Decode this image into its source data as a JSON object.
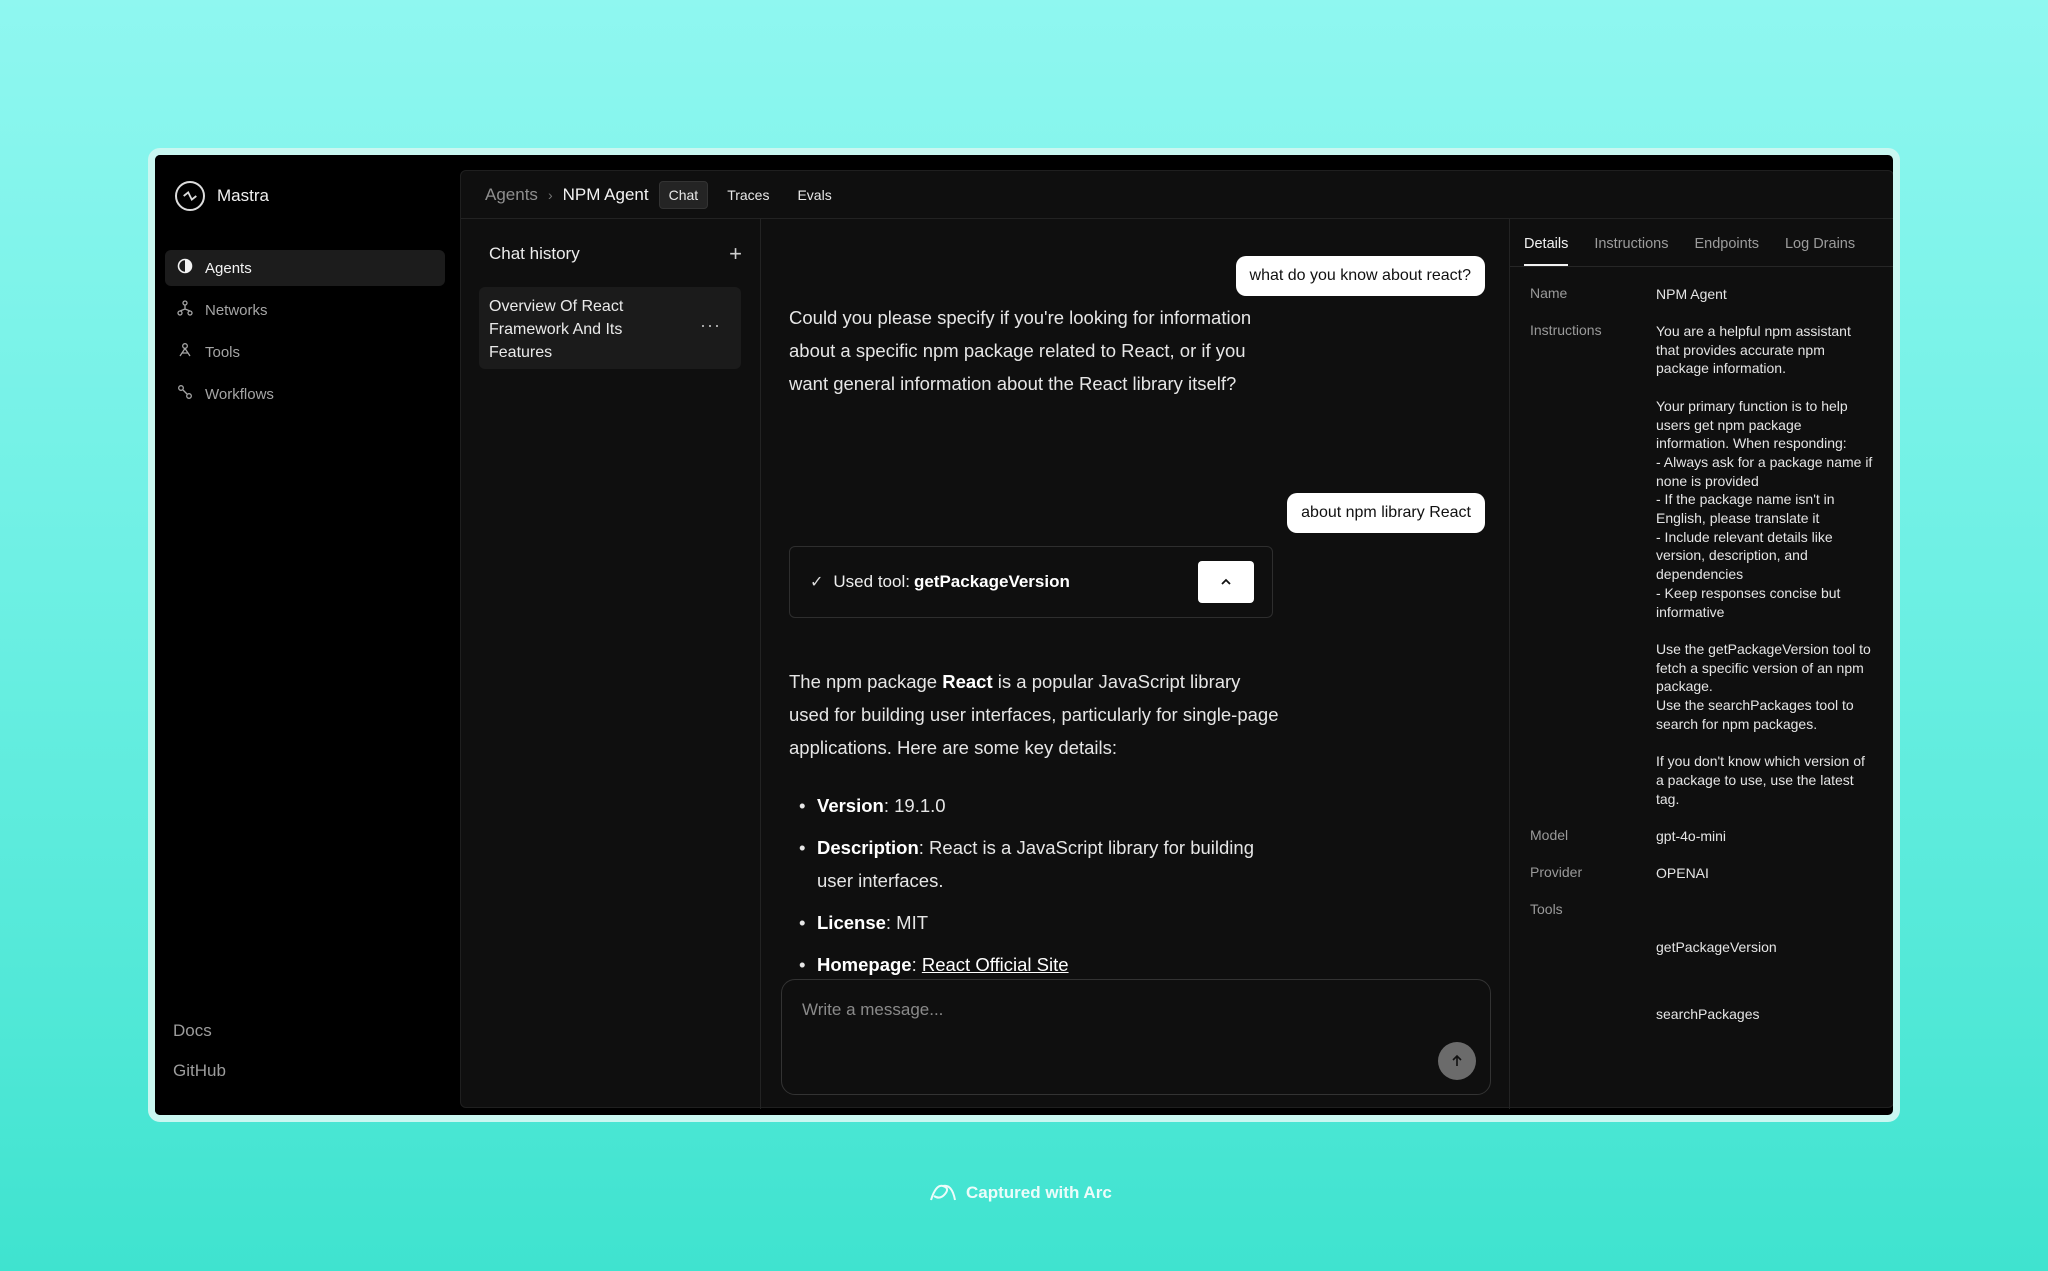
{
  "app": {
    "name": "Mastra"
  },
  "sidebar": {
    "items": [
      {
        "label": "Agents",
        "icon": "agents-icon",
        "active": true
      },
      {
        "label": "Networks",
        "icon": "networks-icon"
      },
      {
        "label": "Tools",
        "icon": "tools-icon"
      },
      {
        "label": "Workflows",
        "icon": "workflows-icon"
      }
    ],
    "footer": {
      "docs": "Docs",
      "github": "GitHub"
    }
  },
  "header": {
    "breadcrumb_root": "Agents",
    "breadcrumb_current": "NPM Agent",
    "tabs": [
      "Chat",
      "Traces",
      "Evals"
    ],
    "active_tab": "Chat"
  },
  "history": {
    "title": "Chat history",
    "items": [
      {
        "title": "Overview Of React Framework And Its Features"
      }
    ]
  },
  "chat": {
    "messages": {
      "user1": "what do you know about react?",
      "assistant1": "Could you please specify if you're looking for information about a specific npm package related to React, or if you want general information about the React library itself?",
      "user2": "about npm library React",
      "tool_prefix": "Used tool:",
      "tool_name": "getPackageVersion",
      "assistant2_pre": "The npm package ",
      "assistant2_bold": "React",
      "assistant2_post": " is a popular JavaScript library used for building user interfaces, particularly for single-page applications. Here are some key details:"
    },
    "details": [
      {
        "label": "Version",
        "value": ": 19.1.0"
      },
      {
        "label": "Description",
        "value": ": React is a JavaScript library for building user interfaces."
      },
      {
        "label": "License",
        "value": ": MIT"
      },
      {
        "label": "Homepage",
        "value": ": ",
        "link": "React Official Site"
      }
    ],
    "composer_placeholder": "Write a message..."
  },
  "panel": {
    "tabs": [
      "Details",
      "Instructions",
      "Endpoints",
      "Log Drains"
    ],
    "active_tab": "Details",
    "labels": {
      "name": "Name",
      "instructions": "Instructions",
      "model": "Model",
      "provider": "Provider",
      "tools": "Tools"
    },
    "name": "NPM Agent",
    "instructions": "You are a helpful npm assistant that provides accurate npm package information.\n\nYour primary function is to help users get npm package information. When responding:\n- Always ask for a package name if none is provided\n- If the package name isn't in English, please translate it\n- Include relevant details like version, description, and dependencies\n- Keep responses concise but informative\n\nUse the getPackageVersion tool to fetch a specific version of an npm package.\nUse the searchPackages tool to search for npm packages.\n\nIf you don't know which version of a package to use, use the latest tag.",
    "model": "gpt-4o-mini",
    "provider": "OPENAI",
    "tools": [
      "getPackageVersion",
      "searchPackages"
    ]
  },
  "capture": {
    "label": "Captured with Arc"
  }
}
